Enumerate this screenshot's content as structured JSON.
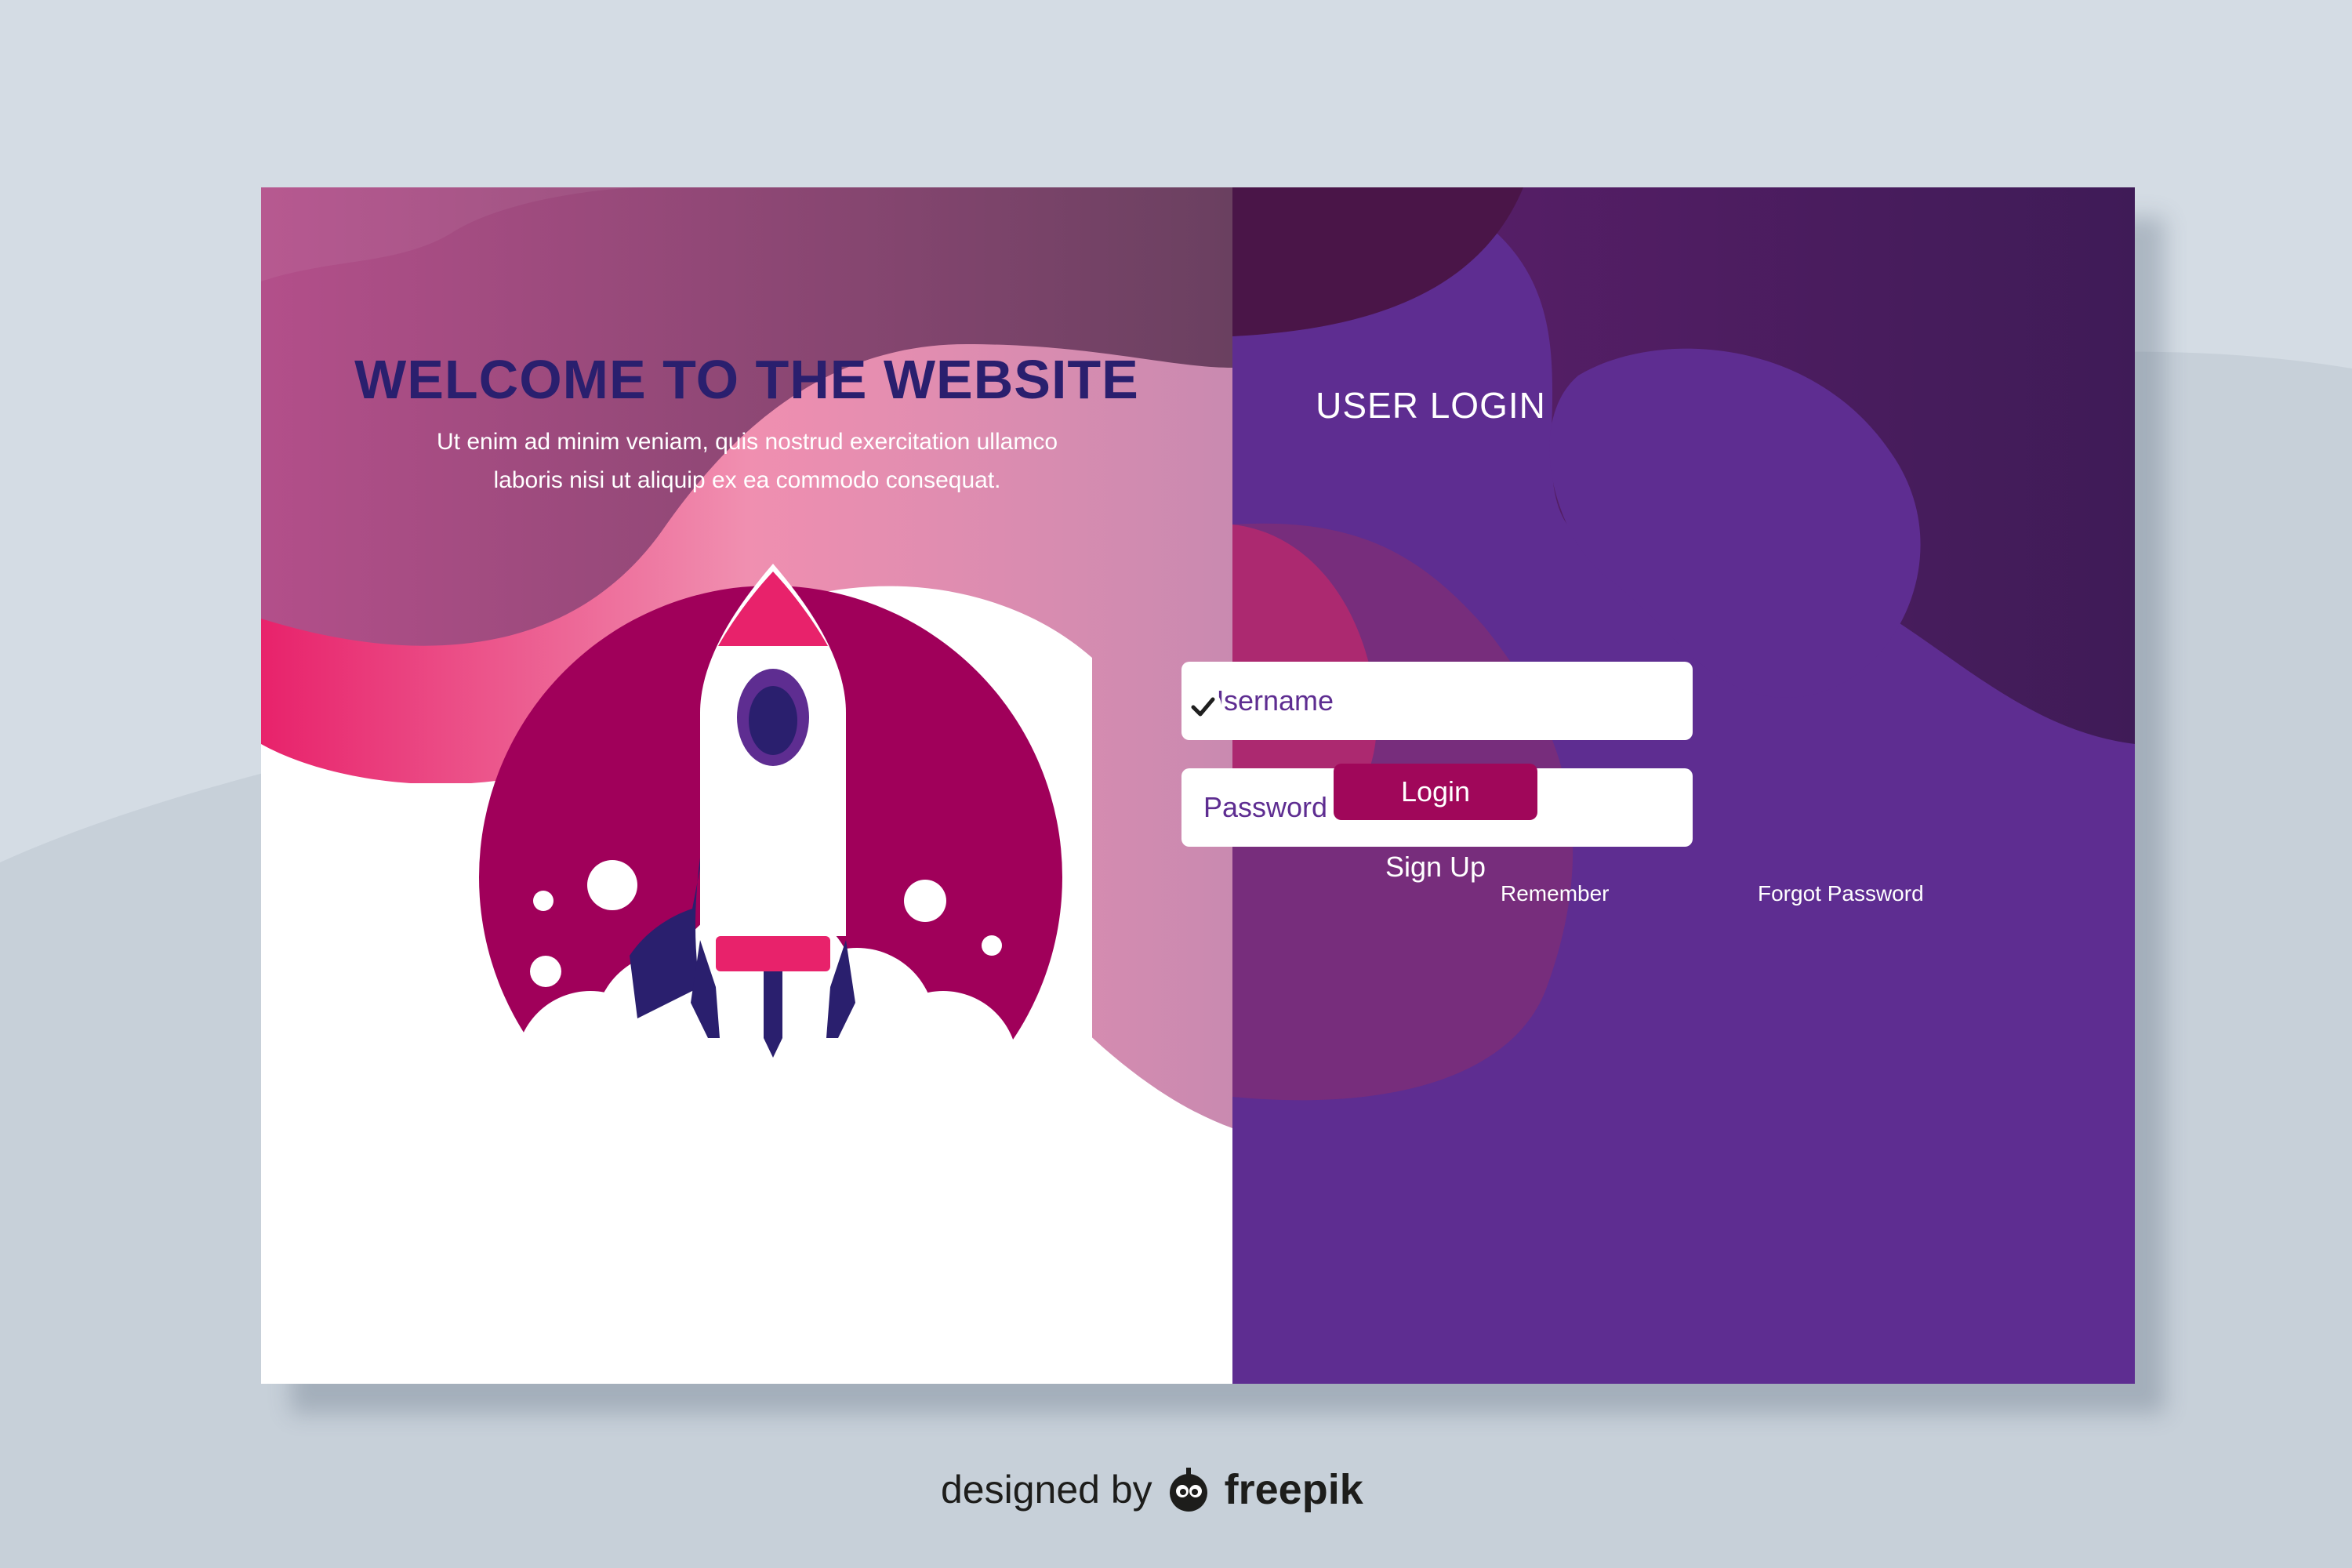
{
  "welcome": {
    "title": "WELCOME TO THE WEBSITE",
    "body": "Ut enim ad minim veniam, quis nostrud exercitation ullamco laboris nisi ut aliquip ex ea commodo consequat."
  },
  "login": {
    "title": "USER LOGIN",
    "username_placeholder": "Username",
    "password_placeholder": "Password",
    "remember_label": "Remember",
    "remember_checked": true,
    "forgot_label": "Forgot Password",
    "login_button": "Login",
    "signup_label": "Sign Up"
  },
  "footer": {
    "designed_by": "designed by",
    "brand": "freepik"
  },
  "icons": {
    "username": "user-icon",
    "password": "lock-icon",
    "remember": "check-icon",
    "brand": "freepik-logo-icon",
    "illustration": "rocket-icon"
  },
  "colors": {
    "page_background": "#d4dce4",
    "login_panel": "#5e2d91",
    "accent_magenta": "#a0075a",
    "accent_pink": "#e8226b",
    "title_navy": "#2a1f6e"
  }
}
